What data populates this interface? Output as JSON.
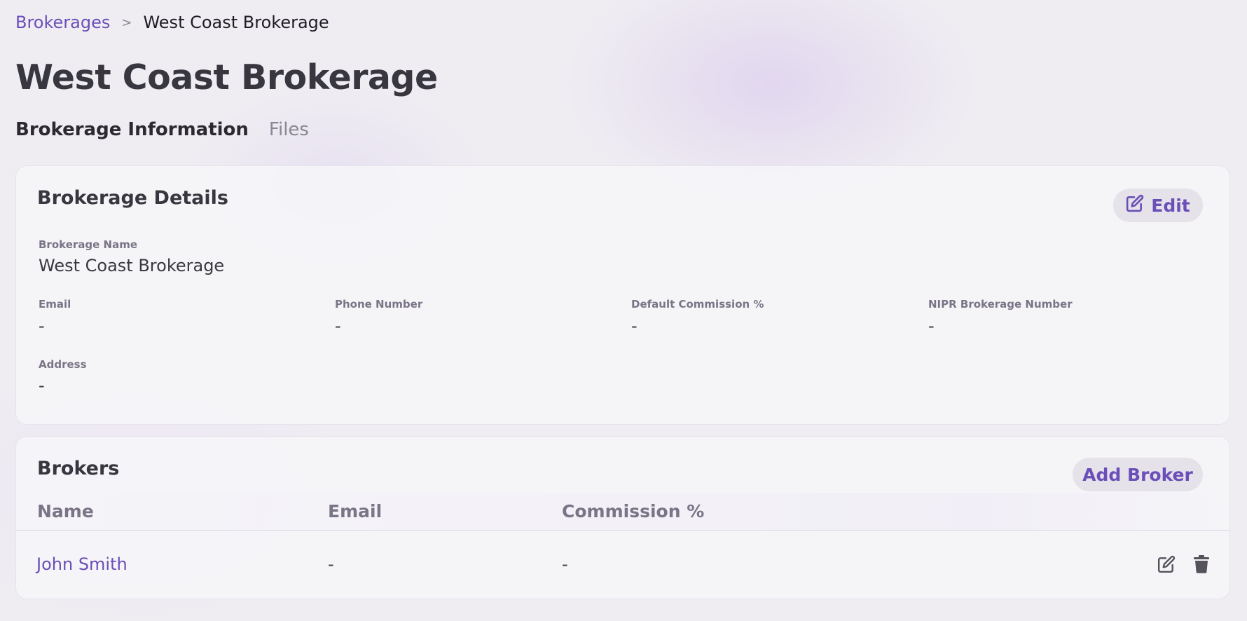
{
  "breadcrumb": {
    "parent": "Brokerages",
    "separator": ">",
    "current": "West Coast Brokerage"
  },
  "page_title": "West Coast Brokerage",
  "tabs": [
    {
      "label": "Brokerage Information",
      "active": true
    },
    {
      "label": "Files",
      "active": false
    }
  ],
  "details": {
    "title": "Brokerage Details",
    "edit_label": "Edit",
    "fields": {
      "name": {
        "label": "Brokerage Name",
        "value": "West Coast Brokerage"
      },
      "email": {
        "label": "Email",
        "value": "-"
      },
      "phone": {
        "label": "Phone Number",
        "value": "-"
      },
      "commission": {
        "label": "Default Commission %",
        "value": "-"
      },
      "nipr": {
        "label": "NIPR Brokerage Number",
        "value": "-"
      },
      "address": {
        "label": "Address",
        "value": "-"
      }
    }
  },
  "brokers": {
    "title": "Brokers",
    "add_label": "Add Broker",
    "columns": [
      "Name",
      "Email",
      "Commission %"
    ],
    "rows": [
      {
        "name": "John Smith",
        "email": "-",
        "commission": "-"
      }
    ]
  },
  "colors": {
    "accent": "#6a4fb8",
    "text": "#3a3840",
    "muted": "#7a7486",
    "background": "#efedf2"
  },
  "icons": {
    "edit": "pencil-square-icon",
    "delete": "trash-icon",
    "separator": "chevron-right"
  }
}
